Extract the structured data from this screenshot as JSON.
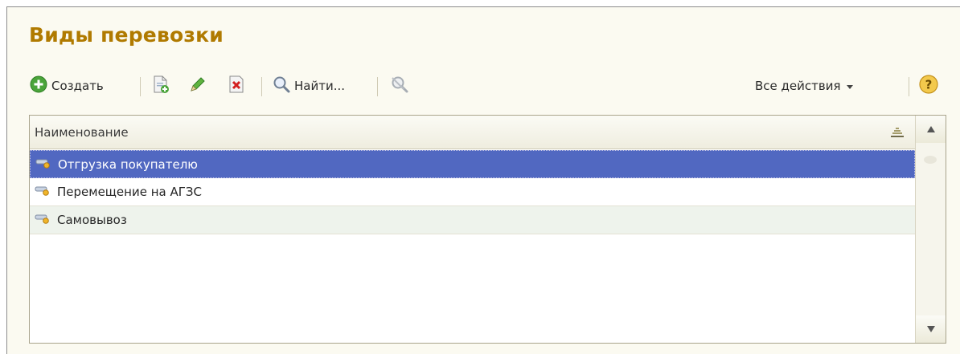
{
  "form": {
    "title": "Виды перевозки"
  },
  "toolbar": {
    "create_label": "Создать",
    "find_label": "Найти...",
    "all_actions_label": "Все действия"
  },
  "table": {
    "column_header": "Наименование",
    "rows": [
      {
        "label": "Отгрузка покупателю",
        "selected": true
      },
      {
        "label": "Перемещение на АГЗС",
        "selected": false
      },
      {
        "label": "Самовывоз",
        "selected": false
      }
    ]
  },
  "icons": {
    "create": "plus-circle-icon",
    "copy": "copy-icon",
    "edit": "pencil-icon",
    "delete": "delete-icon",
    "find": "magnifier-icon",
    "cancel_search": "cancel-search-icon",
    "help": "help-icon",
    "sort": "sort-icon",
    "row": "catalog-item-icon"
  },
  "colors": {
    "title": "#b07a00",
    "selection": "#5168c1",
    "alt_row": "#eef3ec",
    "background": "#fbfaf1"
  }
}
